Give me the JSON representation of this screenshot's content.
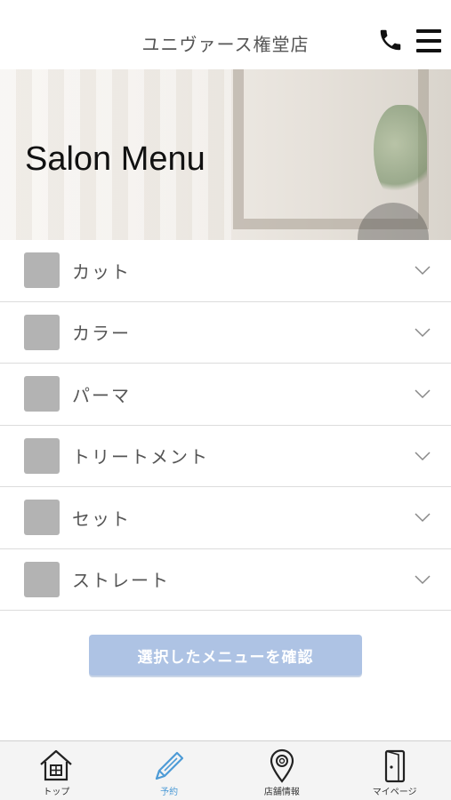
{
  "header": {
    "title": "ユニヴァース権堂店"
  },
  "hero": {
    "title": "Salon Menu"
  },
  "menu_items": [
    {
      "label": "カット"
    },
    {
      "label": "カラー"
    },
    {
      "label": "パーマ"
    },
    {
      "label": "トリートメント"
    },
    {
      "label": "セット"
    },
    {
      "label": "ストレート"
    }
  ],
  "confirm_button": {
    "label": "選択したメニューを確認"
  },
  "tabbar": {
    "active": "予約",
    "tabs": [
      {
        "label": "トップ",
        "icon": "home-icon"
      },
      {
        "label": "予約",
        "icon": "pencil-icon"
      },
      {
        "label": "店舗情報",
        "icon": "map-pin-icon"
      },
      {
        "label": "マイページ",
        "icon": "door-icon"
      }
    ]
  },
  "colors": {
    "accent": "#4d9bd6",
    "button": "#aec3e4",
    "thumb": "#b3b3b3"
  }
}
